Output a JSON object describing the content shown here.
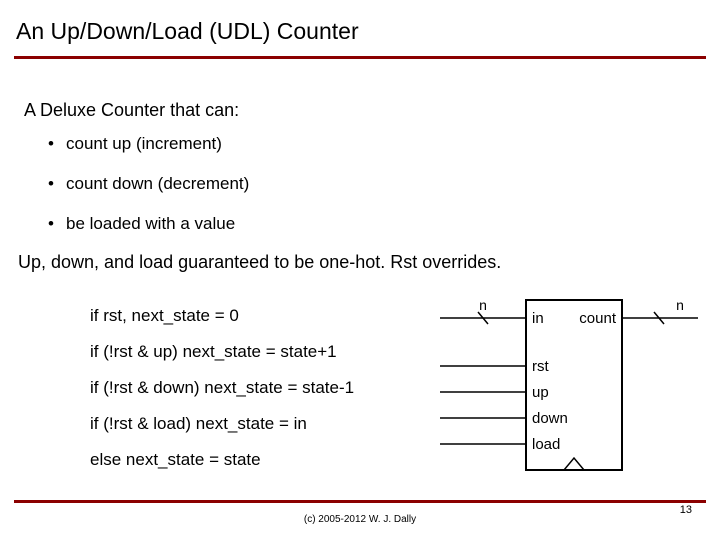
{
  "title": "An Up/Down/Load (UDL) Counter",
  "intro": "A Deluxe Counter that can:",
  "features": [
    "count up (increment)",
    "count down (decrement)",
    "be loaded with a value"
  ],
  "note": "Up, down, and load guaranteed to be one-hot.  Rst overrides.",
  "code": [
    "if rst, next_state = 0",
    "if (!rst & up) next_state = state+1",
    "if (!rst & down) next_state = state-1",
    "if (!rst & load) next_state = in",
    "else next_state = state"
  ],
  "diagram": {
    "left_bus_label": "n",
    "right_bus_label": "n",
    "ports_left": [
      "in",
      "rst",
      "up",
      "down",
      "load"
    ],
    "ports_right": [
      "count"
    ]
  },
  "copyright": "(c) 2005-2012 W. J. Dally",
  "page_number": "13"
}
